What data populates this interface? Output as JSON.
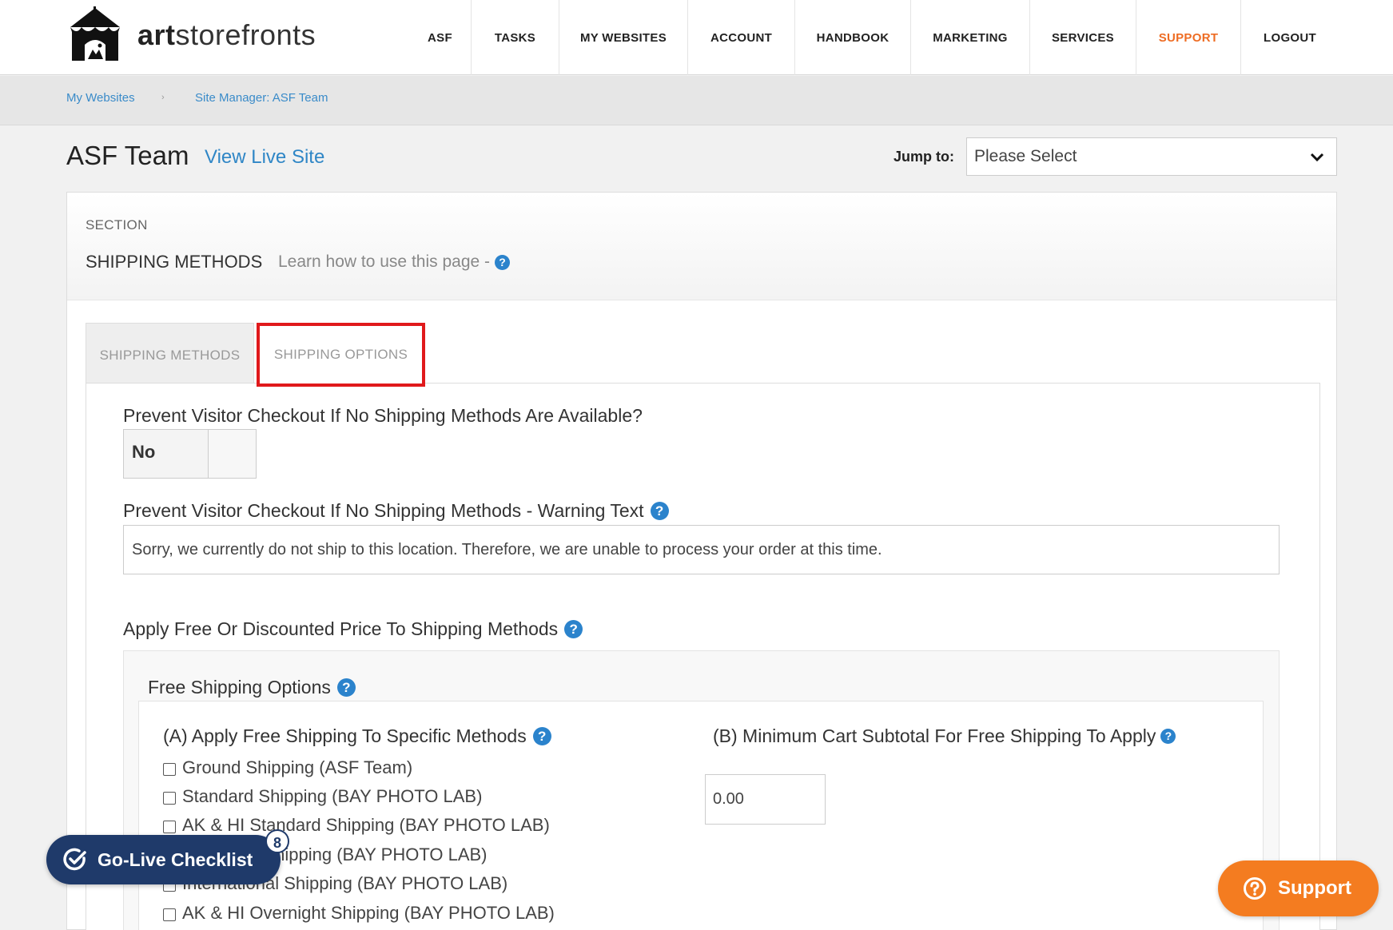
{
  "brand": {
    "logo_bold": "art",
    "logo_light": "storefronts"
  },
  "nav": [
    {
      "label": "ASF"
    },
    {
      "label": "TASKS"
    },
    {
      "label": "MY WEBSITES"
    },
    {
      "label": "ACCOUNT"
    },
    {
      "label": "HANDBOOK"
    },
    {
      "label": "MARKETING"
    },
    {
      "label": "SERVICES"
    },
    {
      "label": "SUPPORT"
    },
    {
      "label": "LOGOUT"
    }
  ],
  "breadcrumb": {
    "item1": "My Websites",
    "separator": "›",
    "item2": "Site Manager: ASF Team"
  },
  "page": {
    "title": "ASF Team",
    "live_link": "View Live Site",
    "jump_label": "Jump to:",
    "jump_value": "Please Select"
  },
  "section": {
    "small_label": "SECTION",
    "title": "SHIPPING METHODS",
    "learn": "Learn how to use this page -"
  },
  "tabs": [
    {
      "label": "SHIPPING METHODS"
    },
    {
      "label": "SHIPPING OPTIONS"
    }
  ],
  "form": {
    "prevent_label": "Prevent Visitor Checkout If No Shipping Methods Are Available?",
    "prevent_value": "No",
    "warning_label": "Prevent Visitor Checkout If No Shipping Methods - Warning Text",
    "warning_value": "Sorry, we currently do not ship to this location.  Therefore, we are unable to process your order at this time.",
    "discount_label": "Apply Free Or Discounted Price To Shipping Methods",
    "free_options_label": "Free Shipping Options",
    "specific_label": "(A) Apply Free Shipping To Specific Methods",
    "methods": [
      {
        "label": "Ground Shipping (ASF Team)",
        "checked": false
      },
      {
        "label": "Standard Shipping (BAY PHOTO LAB)",
        "checked": false
      },
      {
        "label": "AK & HI Standard Shipping (BAY PHOTO LAB)",
        "checked": false
      },
      {
        "label": "Overnight Shipping (BAY PHOTO LAB)",
        "checked": false
      },
      {
        "label": "International Shipping (BAY PHOTO LAB)",
        "checked": false
      },
      {
        "label": "AK & HI Overnight Shipping (BAY PHOTO LAB)",
        "checked": false
      }
    ],
    "min_label": "(B) Minimum Cart Subtotal For Free Shipping To Apply",
    "min_value": "0.00"
  },
  "floating": {
    "golive_label": "Go-Live Checklist",
    "golive_count": "8",
    "support_label": "Support"
  },
  "colors": {
    "accent_orange": "#ee6c23",
    "link_blue": "#2f86c6",
    "highlight_red": "#e0191b",
    "navy": "#1f3a6a"
  },
  "icons": [
    "circus-tent-logo-icon",
    "chevron-down-icon",
    "help-icon",
    "check-circle-icon",
    "question-circle-icon"
  ]
}
